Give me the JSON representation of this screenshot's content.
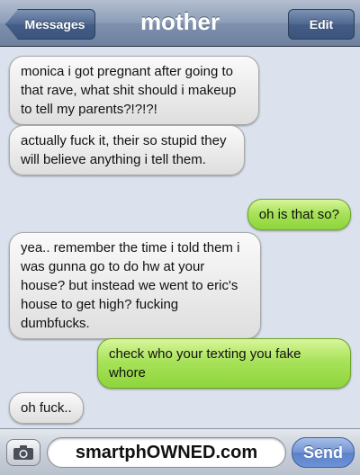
{
  "nav": {
    "back_label": "Messages",
    "title": "mother",
    "edit_label": "Edit"
  },
  "messages": [
    {
      "sender": "them",
      "text": "monica i got pregnant after going to that rave, what shit should i makeup to tell my parents?!?!?!"
    },
    {
      "sender": "them",
      "text": "actually fuck it, their so stupid they will believe anything i tell them."
    },
    {
      "sender": "me",
      "text": "oh is that so?"
    },
    {
      "sender": "them",
      "text": "yea.. remember the time i told them i was gunna go to do hw at your house? but instead we went to eric's house to get high? fucking dumbfucks."
    },
    {
      "sender": "me",
      "text": "check who your texting you fake whore"
    },
    {
      "sender": "them",
      "text": "oh fuck.."
    }
  ],
  "composer": {
    "camera_icon": "camera-icon",
    "input_value": "smartphOWNED.com",
    "send_label": "Send"
  },
  "colors": {
    "incoming_bubble": "#e9e9e9",
    "outgoing_bubble": "#a8e25a",
    "background": "#dbe2ed",
    "navbar": "#8c9db7"
  }
}
